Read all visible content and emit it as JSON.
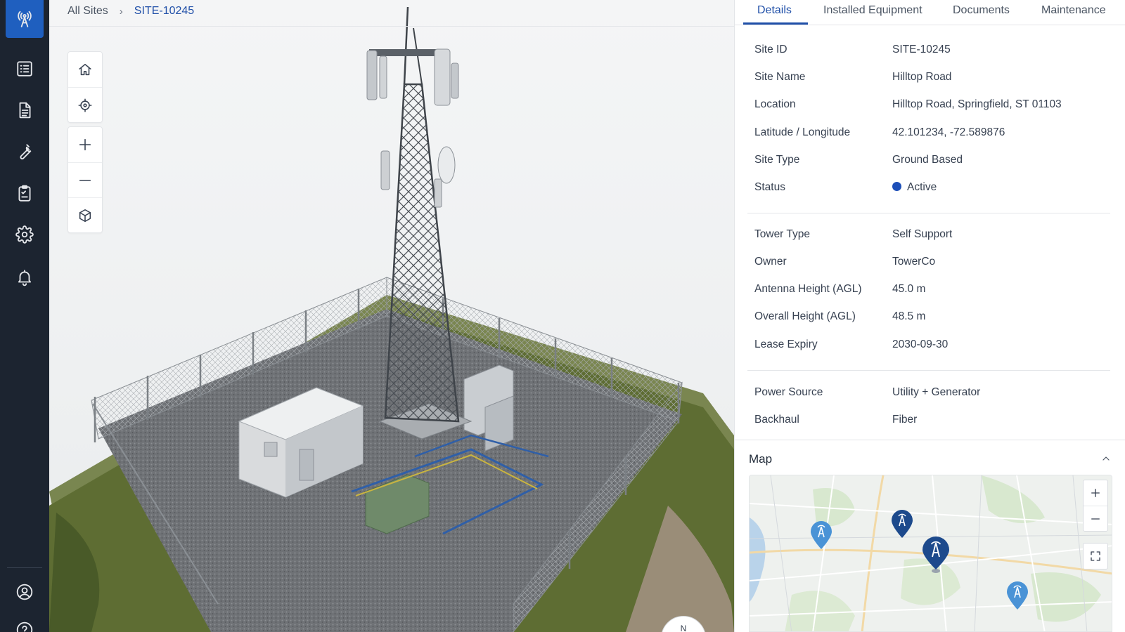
{
  "breadcrumb": {
    "root": "All Sites",
    "separator": "›",
    "current": "SITE-10245"
  },
  "sidebar": {
    "logo_icon": "cell-tower-icon",
    "items": [
      {
        "icon": "list-icon"
      },
      {
        "icon": "document-icon"
      },
      {
        "icon": "wrench-icon"
      },
      {
        "icon": "clipboard-icon"
      },
      {
        "icon": "gear-icon"
      },
      {
        "icon": "bell-icon"
      },
      {
        "icon": "user-circle-icon"
      },
      {
        "icon": "help-icon"
      }
    ]
  },
  "viewer_tools": [
    "home-icon",
    "locate-icon",
    "zoom-in-icon",
    "zoom-out-icon",
    "cube-icon"
  ],
  "compass": {
    "label": "N"
  },
  "tabs": [
    {
      "label": "Details",
      "active": true
    },
    {
      "label": "Installed Equipment",
      "active": false
    },
    {
      "label": "Documents",
      "active": false
    },
    {
      "label": "Maintenance",
      "active": false
    }
  ],
  "details": {
    "general": [
      {
        "label": "Site ID",
        "value": "SITE-10245"
      },
      {
        "label": "Site Name",
        "value": "Hilltop Road"
      },
      {
        "label": "Location",
        "value": "Hilltop Road, Springfield, ST 01103"
      },
      {
        "label": "Latitude / Longitude",
        "value": "42.101234, -72.589876"
      },
      {
        "label": "Site Type",
        "value": "Ground Based"
      },
      {
        "label": "Status",
        "value": "Active"
      }
    ],
    "structure": [
      {
        "label": "Tower Type",
        "value": "Self Support"
      },
      {
        "label": "Owner",
        "value": "TowerCo"
      },
      {
        "label": "Antenna Height (AGL)",
        "value": "45.0 m"
      },
      {
        "label": "Overall Height (AGL)",
        "value": "48.5 m"
      },
      {
        "label": "Lease Expiry",
        "value": "2030-09-30"
      }
    ],
    "utilities": [
      {
        "label": "Power Source",
        "value": "Utility + Generator"
      },
      {
        "label": "Backhaul",
        "value": "Fiber"
      }
    ]
  },
  "map": {
    "title": "Map",
    "controls": [
      "zoom-in-icon",
      "zoom-out-icon",
      "fullscreen-icon"
    ]
  },
  "colors": {
    "sidebar_bg": "#1c2430",
    "brand_blue": "#1f5fbf",
    "accent_text": "#1f4fa8",
    "status_active": "#1d4fb8",
    "pin_light": "#4a93d6",
    "pin_dark": "#1d4a8c"
  }
}
